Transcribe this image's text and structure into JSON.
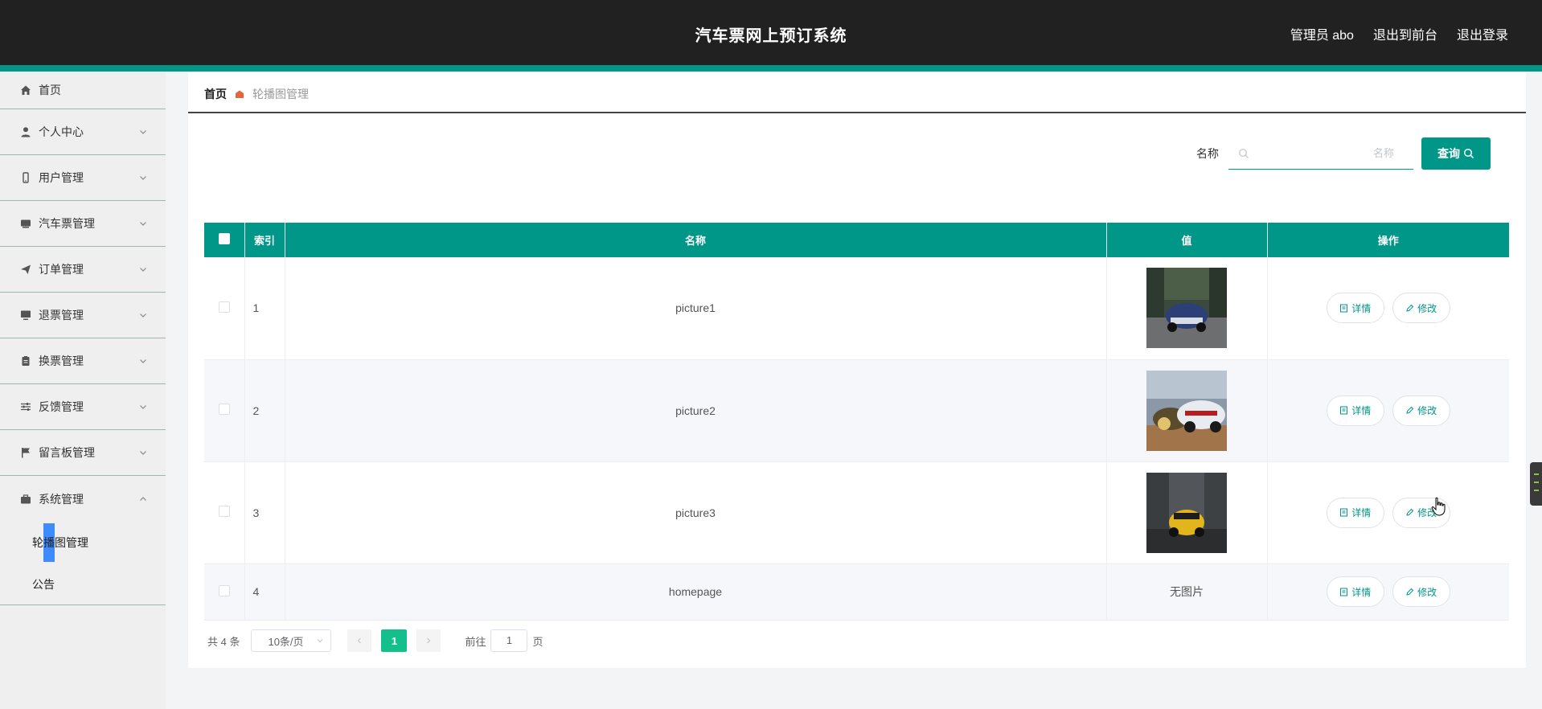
{
  "header": {
    "title": "汽车票网上预订系统",
    "links": [
      "管理员 abo",
      "退出到前台",
      "退出登录"
    ]
  },
  "sidebar": {
    "items": [
      {
        "label": "首页",
        "icon": "home-icon"
      },
      {
        "label": "个人中心",
        "icon": "user-icon"
      },
      {
        "label": "用户管理",
        "icon": "phone-icon"
      },
      {
        "label": "汽车票管理",
        "icon": "ticket-icon"
      },
      {
        "label": "订单管理",
        "icon": "send-icon"
      },
      {
        "label": "退票管理",
        "icon": "monitor-icon"
      },
      {
        "label": "换票管理",
        "icon": "clipboard-icon"
      },
      {
        "label": "反馈管理",
        "icon": "sliders-icon"
      },
      {
        "label": "留言板管理",
        "icon": "flag-icon"
      },
      {
        "label": "系统管理",
        "icon": "briefcase-icon"
      }
    ],
    "sub_items": [
      "轮播图管理",
      "公告"
    ]
  },
  "breadcrumb": {
    "home": "首页",
    "current": "轮播图管理"
  },
  "search": {
    "label": "名称",
    "placeholder": "名称",
    "value": "",
    "button": "查询"
  },
  "table": {
    "columns": [
      "索引",
      "名称",
      "值",
      "操作"
    ],
    "rows": [
      {
        "index": "1",
        "name": "picture1",
        "value": "",
        "has_image": true
      },
      {
        "index": "2",
        "name": "picture2",
        "value": "",
        "has_image": true
      },
      {
        "index": "3",
        "name": "picture3",
        "value": "",
        "has_image": true
      },
      {
        "index": "4",
        "name": "homepage",
        "value": "无图片",
        "has_image": false
      }
    ],
    "actions": {
      "detail": "详情",
      "edit": "修改"
    }
  },
  "pagination": {
    "total": "共 4 条",
    "page_size": "10条/页",
    "current_page": "1",
    "goto_prefix": "前往",
    "goto_value": "1",
    "goto_suffix": "页"
  },
  "colors": {
    "accent": "#009688",
    "header_bg": "#212121",
    "page_active": "#13c08c"
  }
}
